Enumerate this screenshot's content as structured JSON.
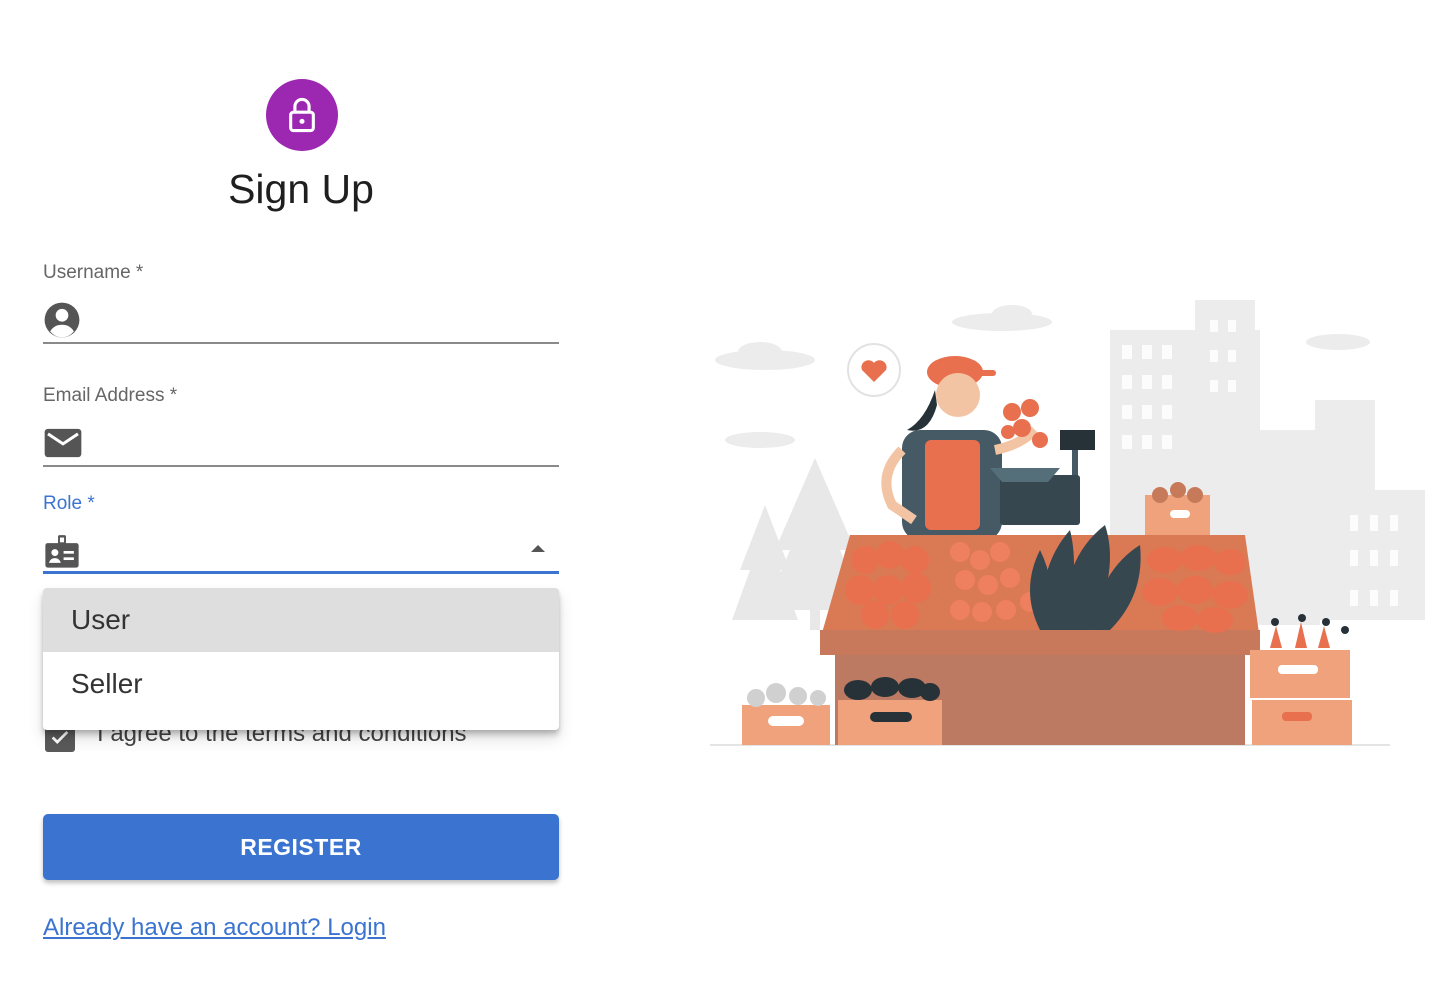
{
  "header": {
    "title": "Sign Up",
    "icon": "lock-icon",
    "avatar_color": "#9c27b0"
  },
  "form": {
    "username": {
      "label": "Username *",
      "value": "",
      "icon": "account-circle-icon"
    },
    "email": {
      "label": "Email Address *",
      "value": "",
      "icon": "mail-icon"
    },
    "role": {
      "label": "Role *",
      "value": "",
      "icon": "badge-icon",
      "open": true
    },
    "role_options": [
      "User",
      "Seller"
    ],
    "highlighted_option": "User",
    "terms": {
      "label": "I agree to the terms and conditions",
      "checked": true
    },
    "register_label": "REGISTER",
    "login_link": "Already have an account? Login"
  },
  "colors": {
    "primary": "#3a73d0",
    "accent": "#e8704f"
  }
}
